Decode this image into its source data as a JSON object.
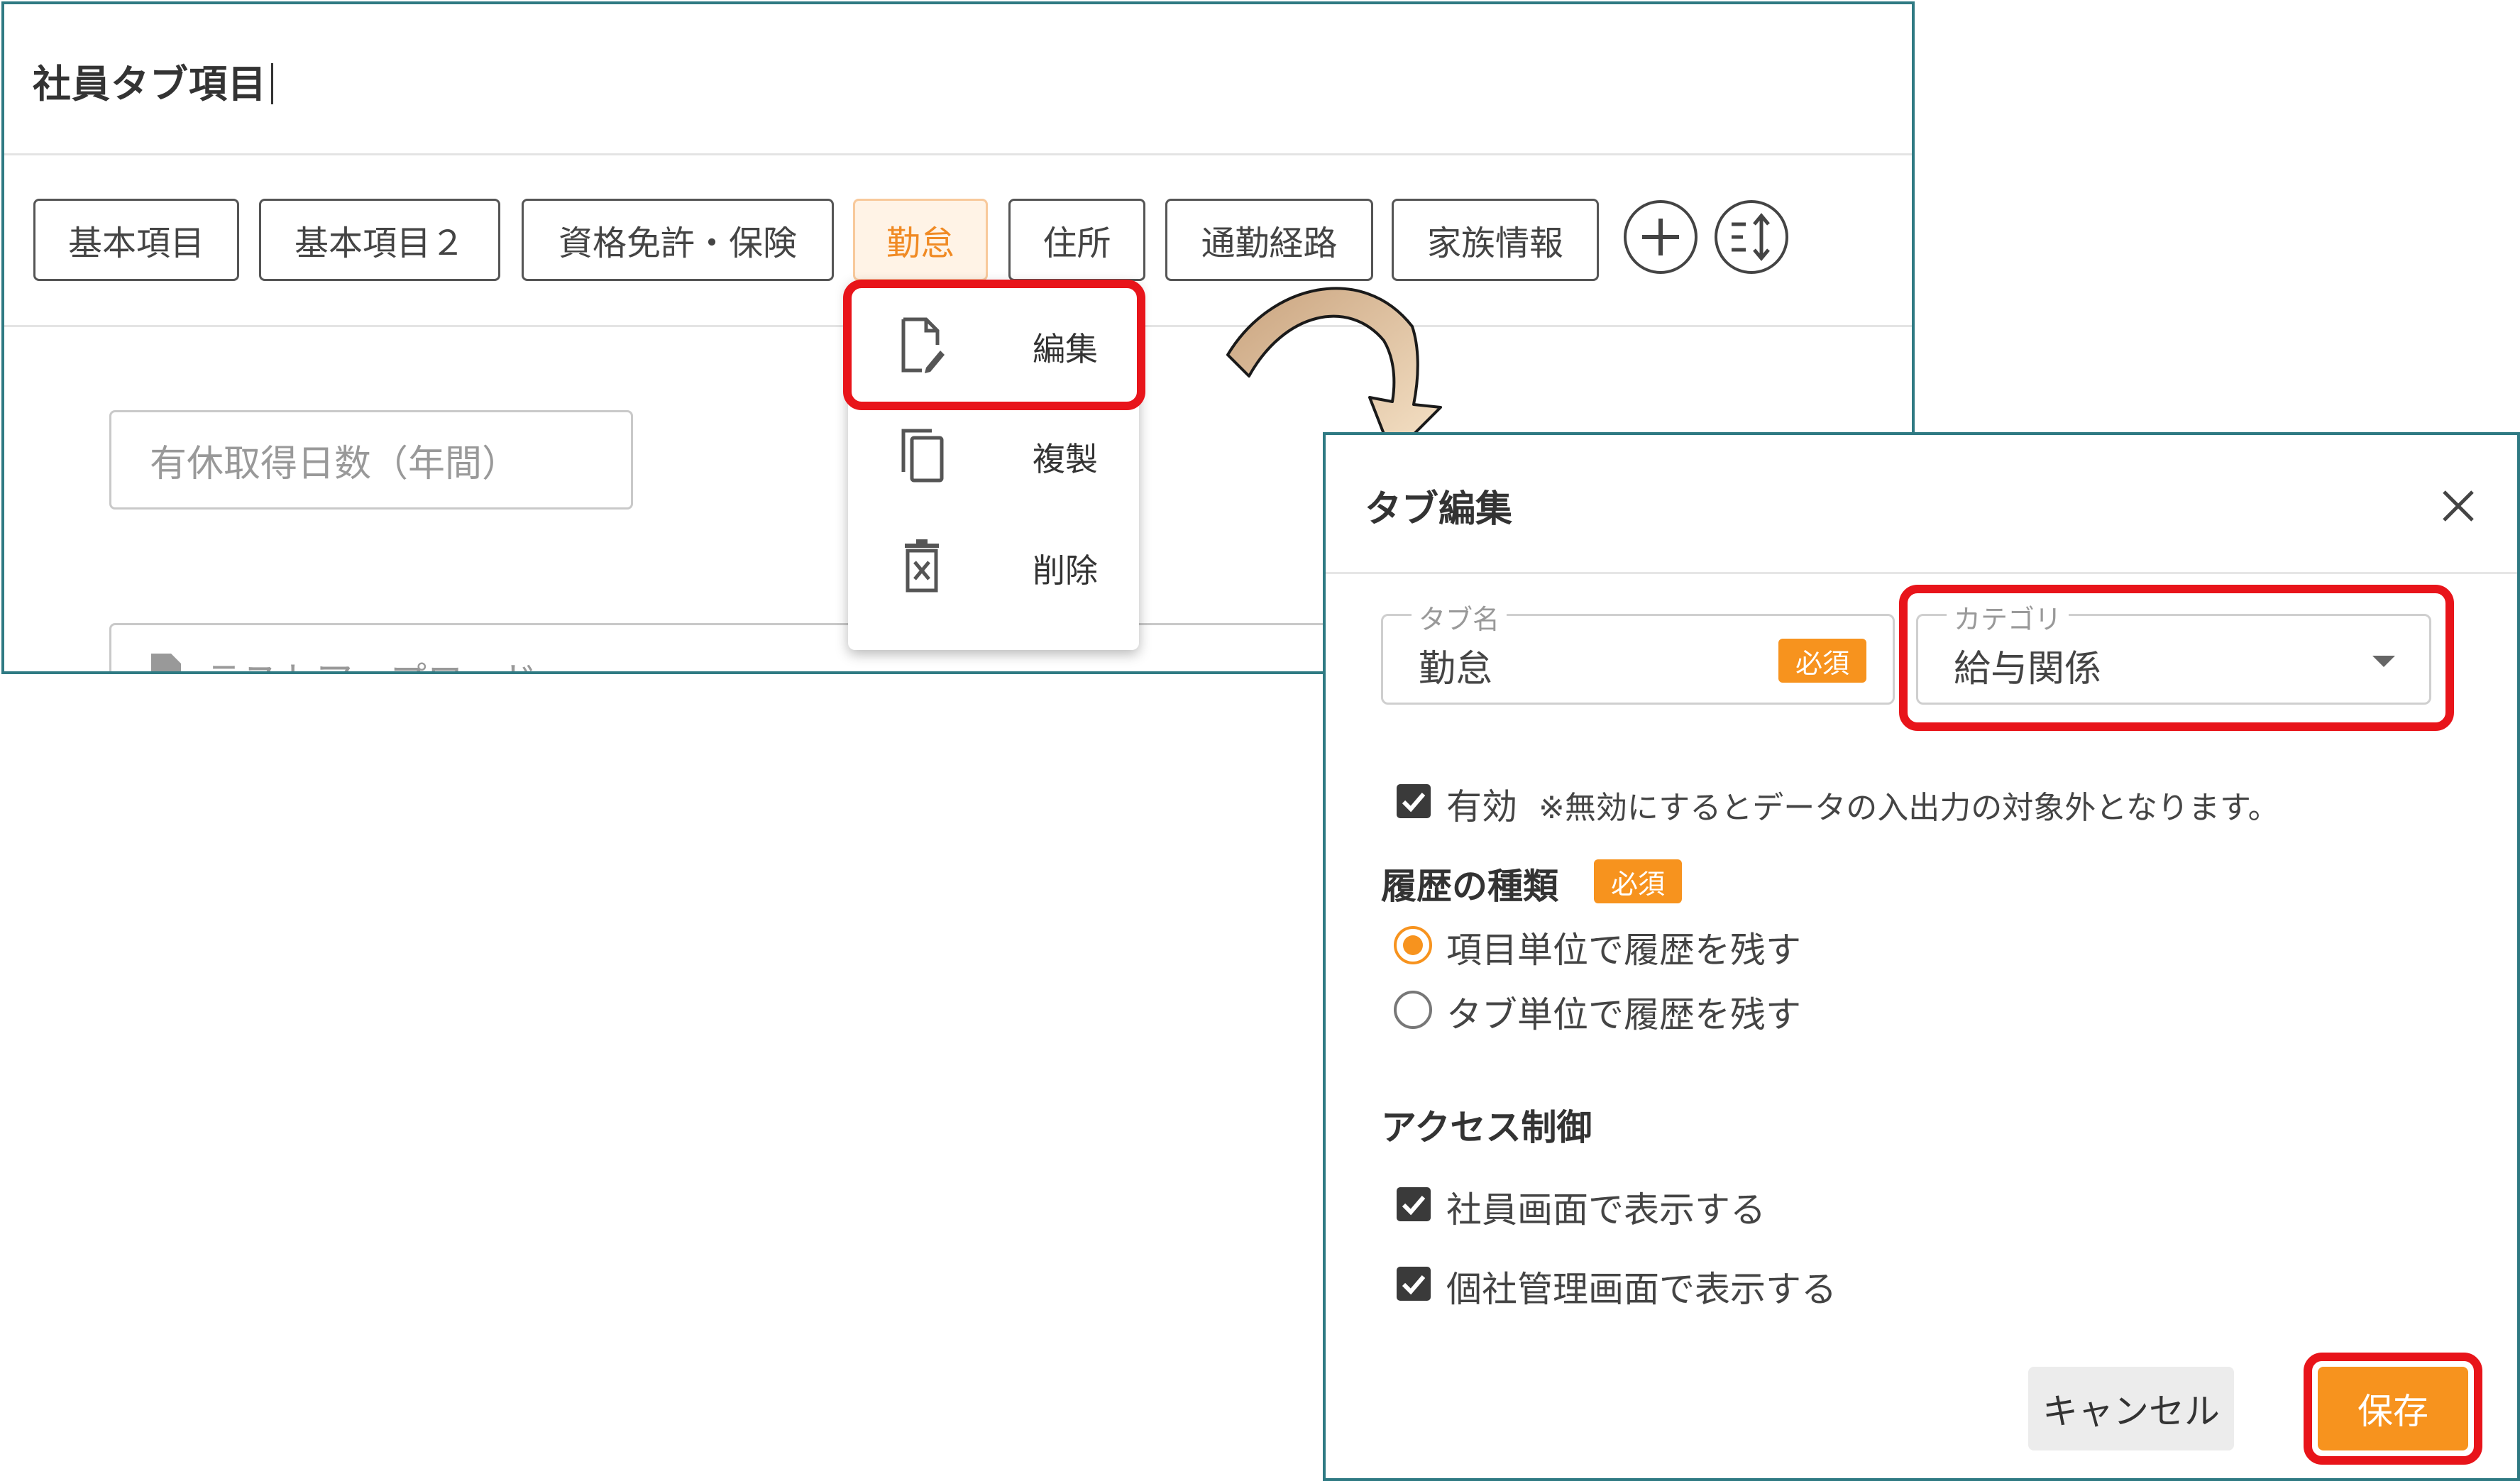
{
  "screen1": {
    "title": "社員タブ項目",
    "tabs": [
      "基本項目",
      "基本項目２",
      "資格免許・保険",
      "勤怠",
      "住所",
      "通勤経路",
      "家族情報"
    ],
    "active_tab": "勤怠",
    "add_icon": "plus-circle-icon",
    "sort_icon": "sort-order-icon",
    "field1": "有休取得日数（年間）",
    "field2": "テストアップロード",
    "menu": {
      "edit": "編集",
      "duplicate": "複製",
      "delete": "削除"
    }
  },
  "dialog": {
    "title": "タブ編集",
    "tab_name_label": "タブ名",
    "tab_name_value": "勤怠",
    "required": "必須",
    "category_label": "カテゴリ",
    "category_value": "給与関係",
    "enabled_label": "有効",
    "enabled_note": "※無効にするとデータの入出力の対象外となります。",
    "history_section": "履歴の種類",
    "history_required": "必須",
    "history_options": [
      "項目単位で履歴を残す",
      "タブ単位で履歴を残す"
    ],
    "history_selected": 0,
    "access_section": "アクセス制御",
    "access_options": [
      "社員画面で表示する",
      "個社管理画面で表示する"
    ],
    "cancel": "キャンセル",
    "save": "保存"
  },
  "colors": {
    "accent": "#f7931e",
    "highlight": "#e8141a",
    "frame": "#2f7a83"
  }
}
